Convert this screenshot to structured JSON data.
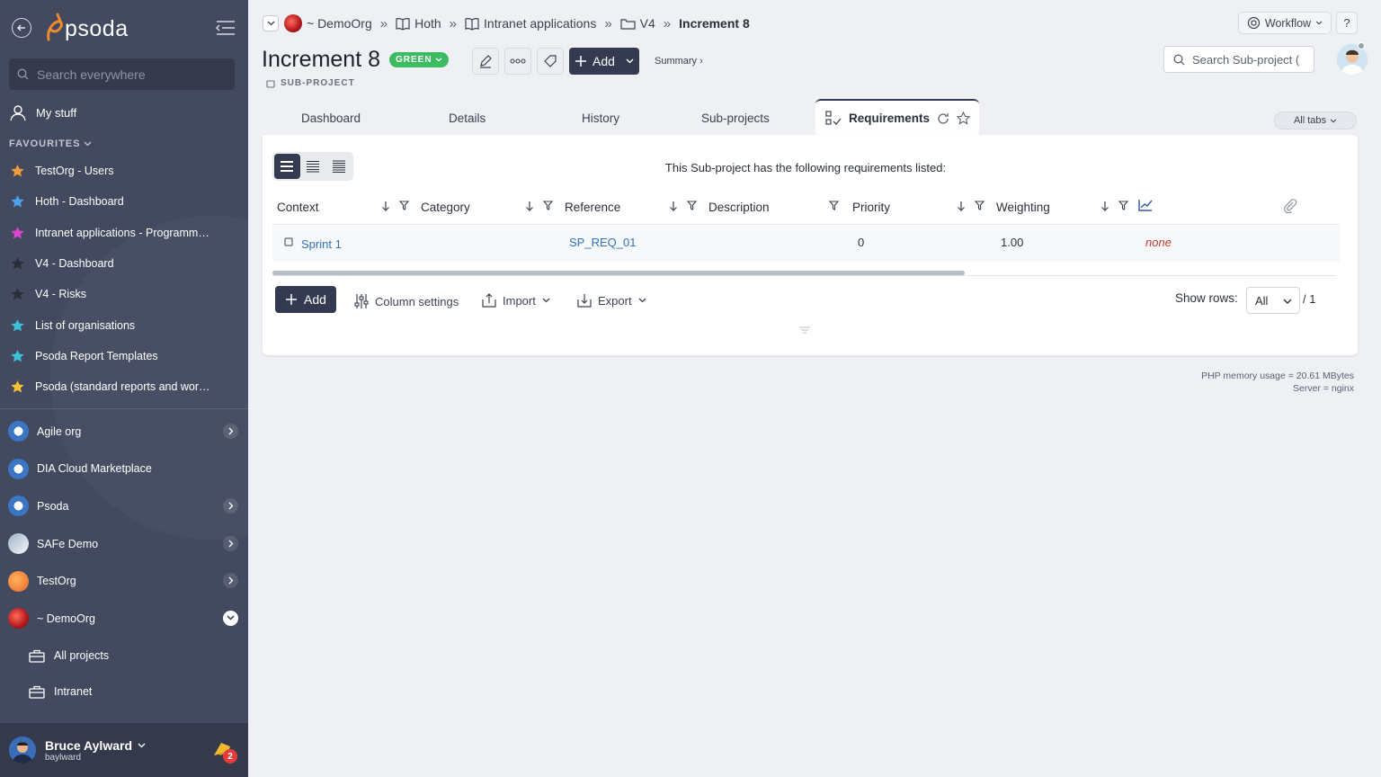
{
  "app": {
    "logo_text": "psoda"
  },
  "sidebar": {
    "search_placeholder": "Search everywhere",
    "my_stuff": "My stuff",
    "favourites_heading": "FAVOURITES",
    "favourites": [
      {
        "label": "TestOrg - Users",
        "color": "#f39c3d"
      },
      {
        "label": "Hoth - Dashboard",
        "color": "#4aa3e8"
      },
      {
        "label": "Intranet applications - Programme…",
        "color": "#d946c9"
      },
      {
        "label": "V4 - Dashboard",
        "color": "#2b2f3a"
      },
      {
        "label": "V4 - Risks",
        "color": "#2b2f3a"
      },
      {
        "label": "List of organisations",
        "color": "#3cc1d8"
      },
      {
        "label": "Psoda Report Templates",
        "color": "#3cc1d8"
      },
      {
        "label": "Psoda (standard reports and work…",
        "color": "#f2c230"
      }
    ],
    "orgs": [
      {
        "label": "Agile org",
        "expanded": false
      },
      {
        "label": "DIA Cloud Marketplace",
        "expanded": null
      },
      {
        "label": "Psoda",
        "expanded": false
      },
      {
        "label": "SAFe Demo",
        "expanded": false
      },
      {
        "label": "TestOrg",
        "expanded": false
      },
      {
        "label": "~ DemoOrg",
        "expanded": true
      }
    ],
    "sub_items": [
      "All projects",
      "Intranet"
    ],
    "user": {
      "name": "Bruce Aylward",
      "login": "baylward",
      "notifications": "2"
    }
  },
  "breadcrumb": {
    "items": [
      "~ DemoOrg",
      "Hoth",
      "Intranet applications",
      "V4",
      "Increment 8"
    ],
    "separator": "»"
  },
  "header": {
    "workflow_label": "Workflow",
    "help_label": "?",
    "title": "Increment 8",
    "status": "GREEN",
    "status_color": "#3dbb61",
    "object_type": "SUB-PROJECT",
    "add_label": "Add",
    "summary_label": "Summary ›",
    "search_placeholder": "Search Sub-project (",
    "accent_color": "#343b51"
  },
  "tabs": {
    "items": [
      "Dashboard",
      "Details",
      "History",
      "Sub-projects",
      "Requirements"
    ],
    "active": "Requirements",
    "all_tabs_label": "All tabs"
  },
  "requirements": {
    "message": "This Sub-project has the following requirements listed:",
    "columns": [
      "Context",
      "Category",
      "Reference",
      "Description",
      "Priority",
      "Weighting"
    ],
    "rows": [
      {
        "context": "Sprint 1",
        "category": "",
        "reference": "SP_REQ_01",
        "description": "",
        "priority": "0",
        "weighting": "1.00",
        "extra": "none"
      }
    ],
    "toolbar": {
      "add_label": "Add",
      "column_settings_label": "Column settings",
      "import_label": "Import",
      "export_label": "Export",
      "show_rows_label": "Show rows:",
      "rows_value": "All",
      "pages_label": "/ 1"
    }
  },
  "footer": {
    "memory": "PHP memory usage = 20.61 MBytes",
    "server": "Server = nginx"
  }
}
